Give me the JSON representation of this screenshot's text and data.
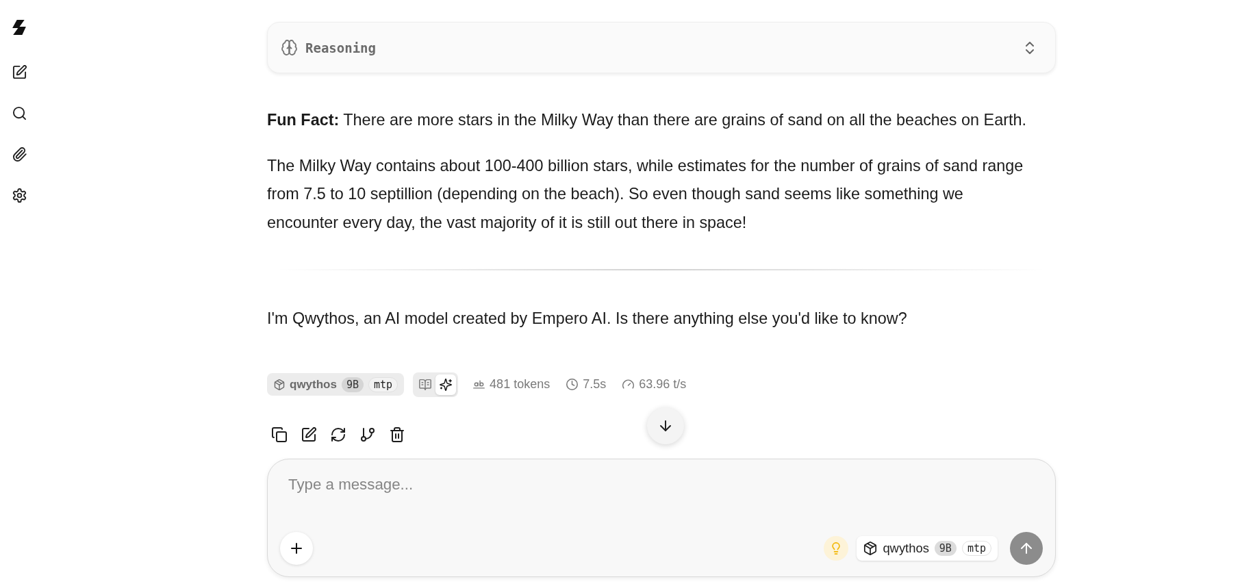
{
  "reasoning": {
    "label": "Reasoning"
  },
  "message": {
    "blocks": [
      {
        "kind": "paragraph",
        "text": "**Fun Fact:** There are more stars in the Milky Way than there are grains of sand on all the beaches on Earth."
      },
      {
        "kind": "paragraph",
        "text": "The Milky Way contains about 100-400 billion stars, while estimates for the number of grains of sand range from 7.5 to 10 septillion (depending on the beach). So even though sand seems like something we encounter every day, the vast majority of it is still out there in space!"
      },
      {
        "kind": "rule"
      },
      {
        "kind": "paragraph",
        "text": "I'm Qwythos, an AI model created by Empero AI. Is there anything else you'd like to know?"
      }
    ]
  },
  "stats": {
    "model": {
      "name": "qwythos",
      "size": "9B",
      "tag": "mtp"
    },
    "view_modes": [
      {
        "selected": false
      },
      {
        "selected": true
      }
    ],
    "tokens": "481 tokens",
    "duration": "7.5s",
    "speed": "63.96 t/s"
  },
  "composer": {
    "placeholder": "Type a message...",
    "reasoning_on": true,
    "model": {
      "name": "qwythos",
      "size": "9B",
      "tag": "mtp"
    },
    "send_disabled": true
  }
}
